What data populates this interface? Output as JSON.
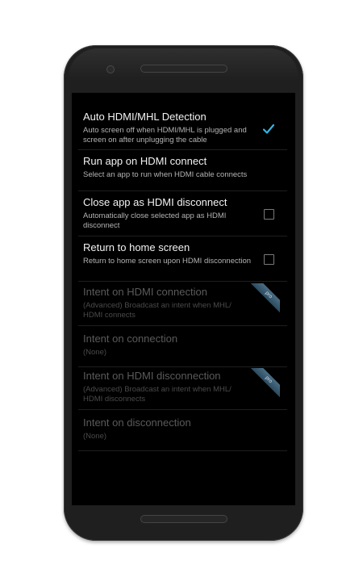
{
  "settings": [
    {
      "title": "Auto HDMI/MHL Detection",
      "summary": "Auto screen off when HDMI/MHL is plugged and screen on after unplugging the cable",
      "checked": true
    },
    {
      "title": "Run app on HDMI connect",
      "summary": "Select an app to run when HDMI cable connects"
    },
    {
      "title": "Close app as HDMI disconnect",
      "summary": "Automatically close selected app as HDMI disconnect",
      "checked": false
    },
    {
      "title": "Return to home screen",
      "summary": "Return to home screen upon HDMI disconnection",
      "checked": false
    },
    {
      "title": "Intent on HDMI connection",
      "summary": "(Advanced) Broadcast an intent when MHL/ HDMI connects",
      "badge": "pro"
    },
    {
      "title": "Intent on connection",
      "summary": "(None)"
    },
    {
      "title": "Intent on HDMI disconnection",
      "summary": "(Advanced) Broadcast an intent when MHL/ HDMI disconnects",
      "badge": "pro"
    },
    {
      "title": "Intent on disconnection",
      "summary": "(None)"
    }
  ],
  "colors": {
    "accent": "#33b5e5",
    "screen_bg": "#000000",
    "frame": "#1f1f1f"
  },
  "icons": {
    "checked": "checkmark-icon",
    "unchecked": "checkbox-icon",
    "pro": "pro-ribbon-icon"
  }
}
